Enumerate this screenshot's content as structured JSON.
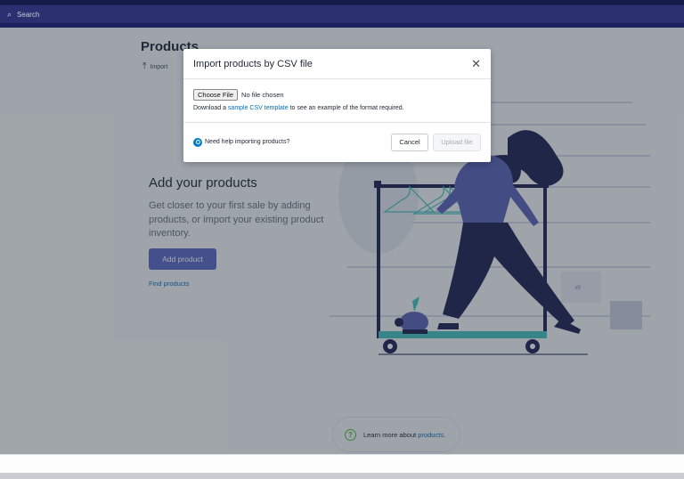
{
  "topbar": {
    "search_placeholder": "Search",
    "search_icon": "search-icon"
  },
  "page": {
    "title": "Products",
    "import_label": "Import"
  },
  "empty_state": {
    "title": "Add your products",
    "body": "Get closer to your first sale by adding products, or import your existing product inventory.",
    "primary_action": "Add product",
    "secondary_action": "Find products"
  },
  "learn_more": {
    "prefix": "Learn more about ",
    "link": "products",
    "suffix": "."
  },
  "modal": {
    "title": "Import products by CSV file",
    "choose_file_label": "Choose File",
    "file_status": "No file chosen",
    "download_prefix": "Download a ",
    "download_link": "sample CSV template",
    "download_suffix": " to see an example of the format required.",
    "help_text": "Need help importing products?",
    "cancel_label": "Cancel",
    "upload_label": "Upload file"
  },
  "colors": {
    "topbar": "#1c2260",
    "primary": "#5c6ac4",
    "link": "#006fbb",
    "illustration_navy": "#1f2452",
    "illustration_purple": "#5a64b8",
    "illustration_teal": "#47c1bf"
  }
}
